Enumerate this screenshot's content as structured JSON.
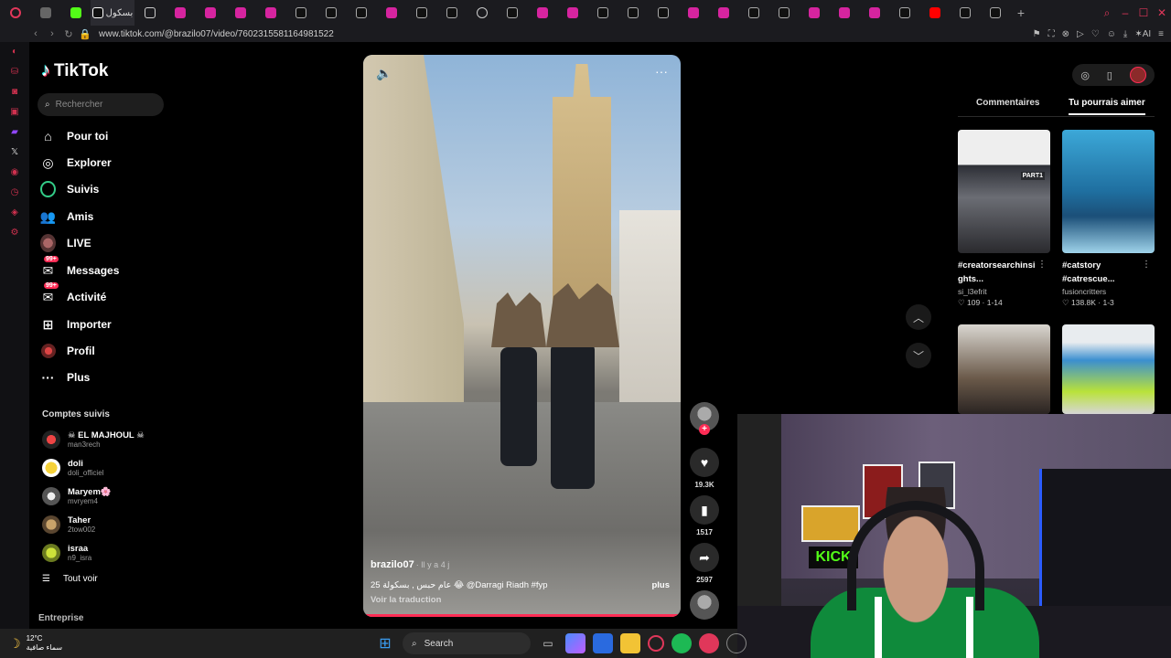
{
  "browser": {
    "active_tab_label": "بسكول",
    "url": "www.tiktok.com/@brazilo07/video/7602315581164981522",
    "colors": {
      "opera_red": "#e0375a",
      "tiktok_red": "#fe2c55",
      "tiktok_cyan": "#25f4ee"
    }
  },
  "sidebar": {
    "brand": "TikTok",
    "search_placeholder": "Rechercher",
    "nav": [
      {
        "label": "Pour toi",
        "icon": "home-icon"
      },
      {
        "label": "Explorer",
        "icon": "compass-icon"
      },
      {
        "label": "Suivis",
        "icon": "following-icon"
      },
      {
        "label": "Amis",
        "icon": "friends-icon"
      },
      {
        "label": "LIVE",
        "icon": "live-icon"
      },
      {
        "label": "Messages",
        "icon": "messages-icon",
        "badge": "99+"
      },
      {
        "label": "Activité",
        "icon": "activity-icon",
        "badge": "99+"
      },
      {
        "label": "Importer",
        "icon": "upload-icon"
      },
      {
        "label": "Profil",
        "icon": "profile-icon"
      },
      {
        "label": "Plus",
        "icon": "more-icon"
      }
    ],
    "followed_title": "Comptes suivis",
    "accounts": [
      {
        "name": "☠ EL MAJHOUL ☠",
        "user": "man3rech"
      },
      {
        "name": "doli",
        "user": "doli_officiel"
      },
      {
        "name": "Maryem🌸",
        "user": "mvryem4"
      },
      {
        "name": "Taher",
        "user": "2tow002"
      },
      {
        "name": "israa",
        "user": "n9_isra"
      }
    ],
    "see_all": "Tout voir",
    "footer": "Entreprise"
  },
  "video": {
    "author": "brazilo07",
    "time": "· Il y a 4 j",
    "caption": "25 عام حبس , بسكولة 😂 @Darragi Riadh #fyp",
    "more": "plus",
    "translate": "Voir la traduction",
    "progress": 1.0,
    "actions": {
      "likes": "19.3K",
      "saves": "1517",
      "shares": "2597"
    }
  },
  "right_panel": {
    "tabs": [
      "Commentaires",
      "Tu pourrais aimer"
    ],
    "active_tab": 1,
    "cards": [
      {
        "title": "#creatorsearchinsi ghts...",
        "author": "si_l3efrit",
        "likes": "109",
        "date": "1-14",
        "tag": "PART1"
      },
      {
        "title": "#catstory #catrescue...",
        "author": "fusioncritters",
        "likes": "138.8K",
        "date": "1-3"
      }
    ]
  },
  "webcam": {
    "kick_label": "KICK"
  },
  "taskbar": {
    "temp": "12°C",
    "weather_text": "سماء صافية",
    "search_label": "Search"
  }
}
